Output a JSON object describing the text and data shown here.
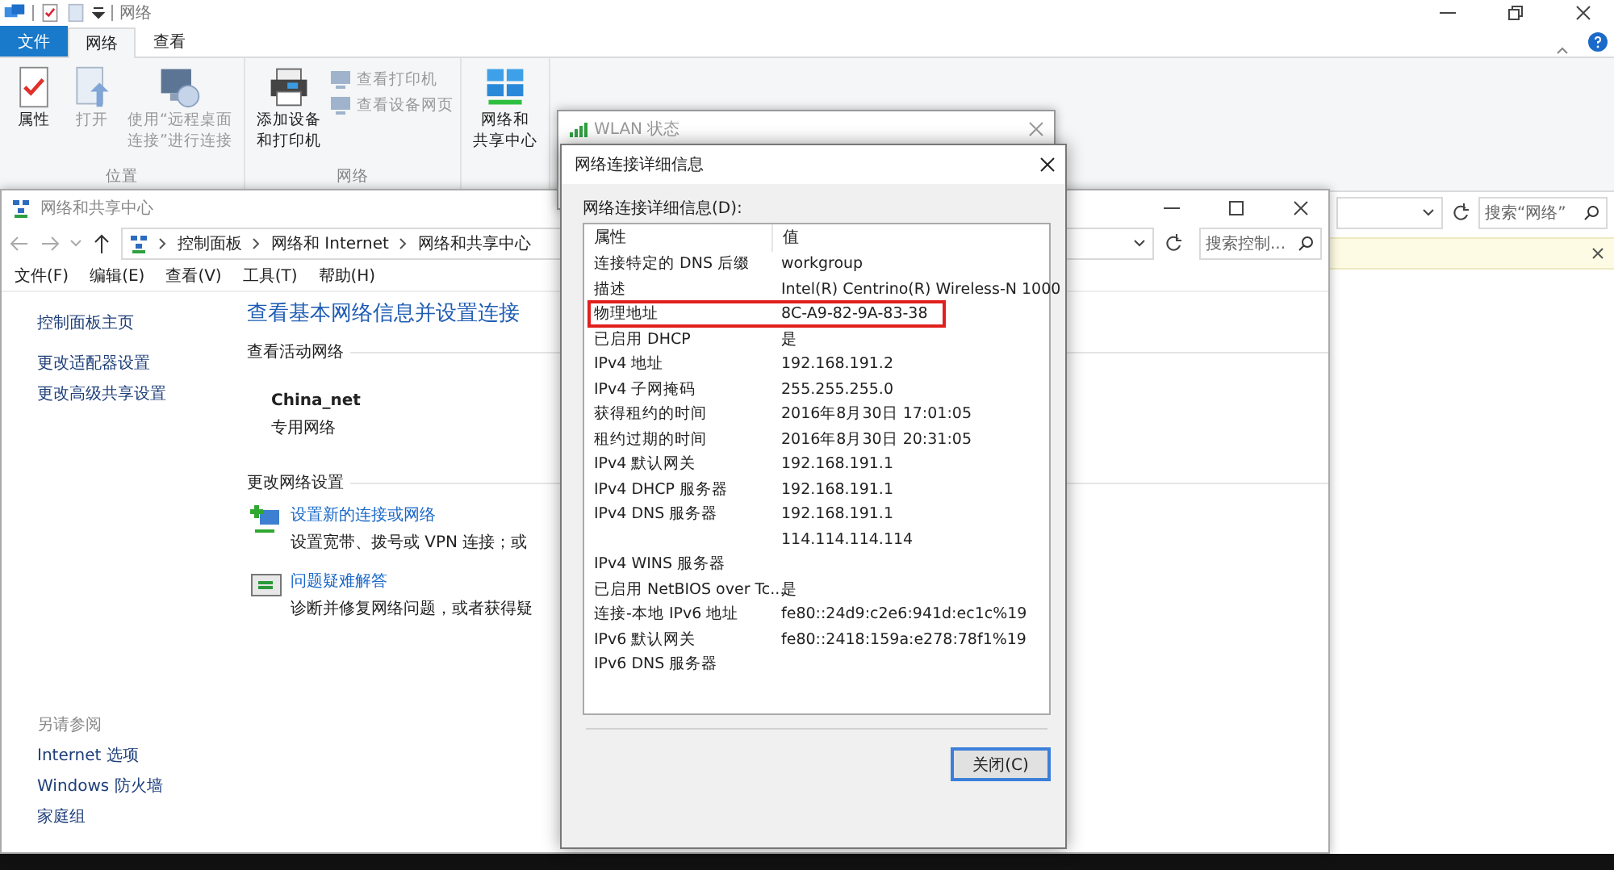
{
  "explorer": {
    "title": "网络",
    "tabs": [
      {
        "label": "文件",
        "selected": false,
        "kind": "file"
      },
      {
        "label": "网络",
        "selected": true,
        "kind": "tab"
      },
      {
        "label": "查看",
        "selected": false,
        "kind": "tab"
      }
    ],
    "ribbon_groups": [
      {
        "label": "位置",
        "large": [
          {
            "lines": [
              "属性"
            ],
            "disabled": false,
            "kind": "properties"
          },
          {
            "lines": [
              "打开"
            ],
            "disabled": true,
            "kind": "open"
          },
          {
            "lines": [
              "使用“远程桌面",
              "连接”进行连接"
            ],
            "disabled": true,
            "kind": "remote"
          }
        ]
      },
      {
        "label": "网络",
        "large": [
          {
            "lines": [
              "添加设备",
              "和打印机"
            ],
            "disabled": false,
            "kind": "printer"
          }
        ],
        "small": [
          {
            "label": "查看打印机",
            "disabled": true
          },
          {
            "label": "查看设备网页",
            "disabled": true
          }
        ]
      },
      {
        "large": [
          {
            "lines": [
              "网络和",
              "共享中心"
            ],
            "disabled": false,
            "kind": "network"
          }
        ]
      }
    ],
    "search": {
      "placeholder": "搜索“网络”"
    }
  },
  "sharing_center": {
    "title": "网络和共享中心",
    "breadcrumb": [
      "控制面板",
      "网络和 Internet",
      "网络和共享中心"
    ],
    "search": {
      "placeholder": "搜索控制..."
    },
    "menu": [
      "文件(F)",
      "编辑(E)",
      "查看(V)",
      "工具(T)",
      "帮助(H)"
    ],
    "sidebar_links": [
      "控制面板主页",
      "更改适配器设置",
      "更改高级共享设置"
    ],
    "see_also": {
      "title": "另请参阅",
      "links": [
        "Internet 选项",
        "Windows 防火墙",
        "家庭组"
      ]
    },
    "heading": "查看基本网络信息并设置连接",
    "active_section": "查看活动网络",
    "network": {
      "name": "China_net",
      "type": "专用网络"
    },
    "change_section": "更改网络设置",
    "tasks": [
      {
        "title": "设置新的连接或网络",
        "desc": "设置宽带、拨号或 VPN 连接；或",
        "kind": "new-connection"
      },
      {
        "title": "问题疑难解答",
        "desc": "诊断并修复网络问题，或者获得疑",
        "kind": "troubleshoot"
      }
    ]
  },
  "wlan_window": {
    "title": "WLAN 状态"
  },
  "details_dialog": {
    "title": "网络连接详细信息",
    "label": "网络连接详细信息(D):",
    "columns": [
      "属性",
      "值"
    ],
    "rows": [
      {
        "property": "连接特定的 DNS 后缀",
        "value": "workgroup",
        "highlighted": false
      },
      {
        "property": "描述",
        "value": "Intel(R) Centrino(R) Wireless-N 1000",
        "highlighted": false
      },
      {
        "property": "物理地址",
        "value": "8C-A9-82-9A-83-38",
        "highlighted": true
      },
      {
        "property": "已启用 DHCP",
        "value": "是",
        "highlighted": false
      },
      {
        "property": "IPv4 地址",
        "value": "192.168.191.2",
        "highlighted": false
      },
      {
        "property": "IPv4 子网掩码",
        "value": "255.255.255.0",
        "highlighted": false
      },
      {
        "property": "获得租约的时间",
        "value": "2016年8月30日 17:01:05",
        "highlighted": false
      },
      {
        "property": "租约过期的时间",
        "value": "2016年8月30日 20:31:05",
        "highlighted": false
      },
      {
        "property": "IPv4 默认网关",
        "value": "192.168.191.1",
        "highlighted": false
      },
      {
        "property": "IPv4 DHCP 服务器",
        "value": "192.168.191.1",
        "highlighted": false
      },
      {
        "property": "IPv4 DNS 服务器",
        "value": "192.168.191.1",
        "highlighted": false
      },
      {
        "value": "114.114.114.114",
        "highlighted": false
      },
      {
        "property": "IPv4 WINS 服务器",
        "highlighted": false
      },
      {
        "property": "已启用 NetBIOS over Tc...",
        "value": "是",
        "highlighted": false
      },
      {
        "property": "连接-本地 IPv6 地址",
        "value": "fe80::24d9:c2e6:941d:ec1c%19",
        "highlighted": false
      },
      {
        "property": "IPv6 默认网关",
        "value": "fe80::2418:159a:e278:78f1%19",
        "highlighted": false
      },
      {
        "property": "IPv6 DNS 服务器",
        "highlighted": false
      }
    ],
    "button": "关闭(C)"
  }
}
